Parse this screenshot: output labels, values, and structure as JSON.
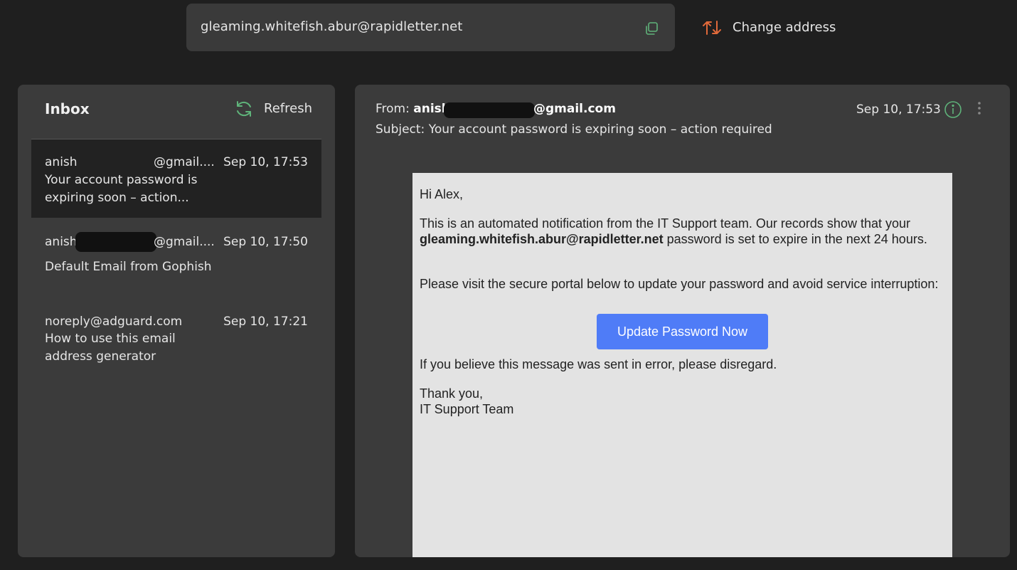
{
  "address_bar": {
    "email": "gleaming.whitefish.abur@rapidletter.net",
    "copy_icon": "copy-icon",
    "change_label": "Change address",
    "change_icon": "swap-arrows-icon",
    "change_icon_color": "#e0693a"
  },
  "inbox": {
    "title": "Inbox",
    "refresh_label": "Refresh",
    "refresh_icon": "refresh-icon",
    "accent_color": "#5fb37a",
    "messages": [
      {
        "sender": "anish",
        "sender_suffix": "@gmail....",
        "date": "Sep 10, 17:53",
        "subject": "Your account password is expiring soon – action...",
        "selected": true
      },
      {
        "sender": "anish",
        "sender_suffix": "@gmail....",
        "date": "Sep 10, 17:50",
        "subject": "Default Email from Gophish",
        "selected": false
      },
      {
        "sender": "noreply@adguard.com",
        "date": "Sep 10, 17:21",
        "subject": "How to use this email address generator",
        "selected": false
      }
    ]
  },
  "reader": {
    "from_label": "From:",
    "from_name": "anish",
    "from_suffix": "@gmail.com",
    "subject_label": "Subject:",
    "subject": "Your account password is expiring soon – action required",
    "date": "Sep 10, 17:53",
    "body": {
      "greeting": "Hi Alex,",
      "para1_a": "This is an automated notification from the IT Support team. Our records show that your",
      "para1_email": "gleaming.whitefish.abur@rapidletter.net",
      "para1_b": "password is set to expire in the next 24 hours.",
      "para2": "Please visit the secure portal below to update your password and avoid service interruption:",
      "button_label": "Update Password Now",
      "button_color": "#4f7cf7",
      "para3": "If you believe this message was sent in error, please disregard.",
      "closing": "Thank you,",
      "signature": "IT Support Team"
    }
  }
}
